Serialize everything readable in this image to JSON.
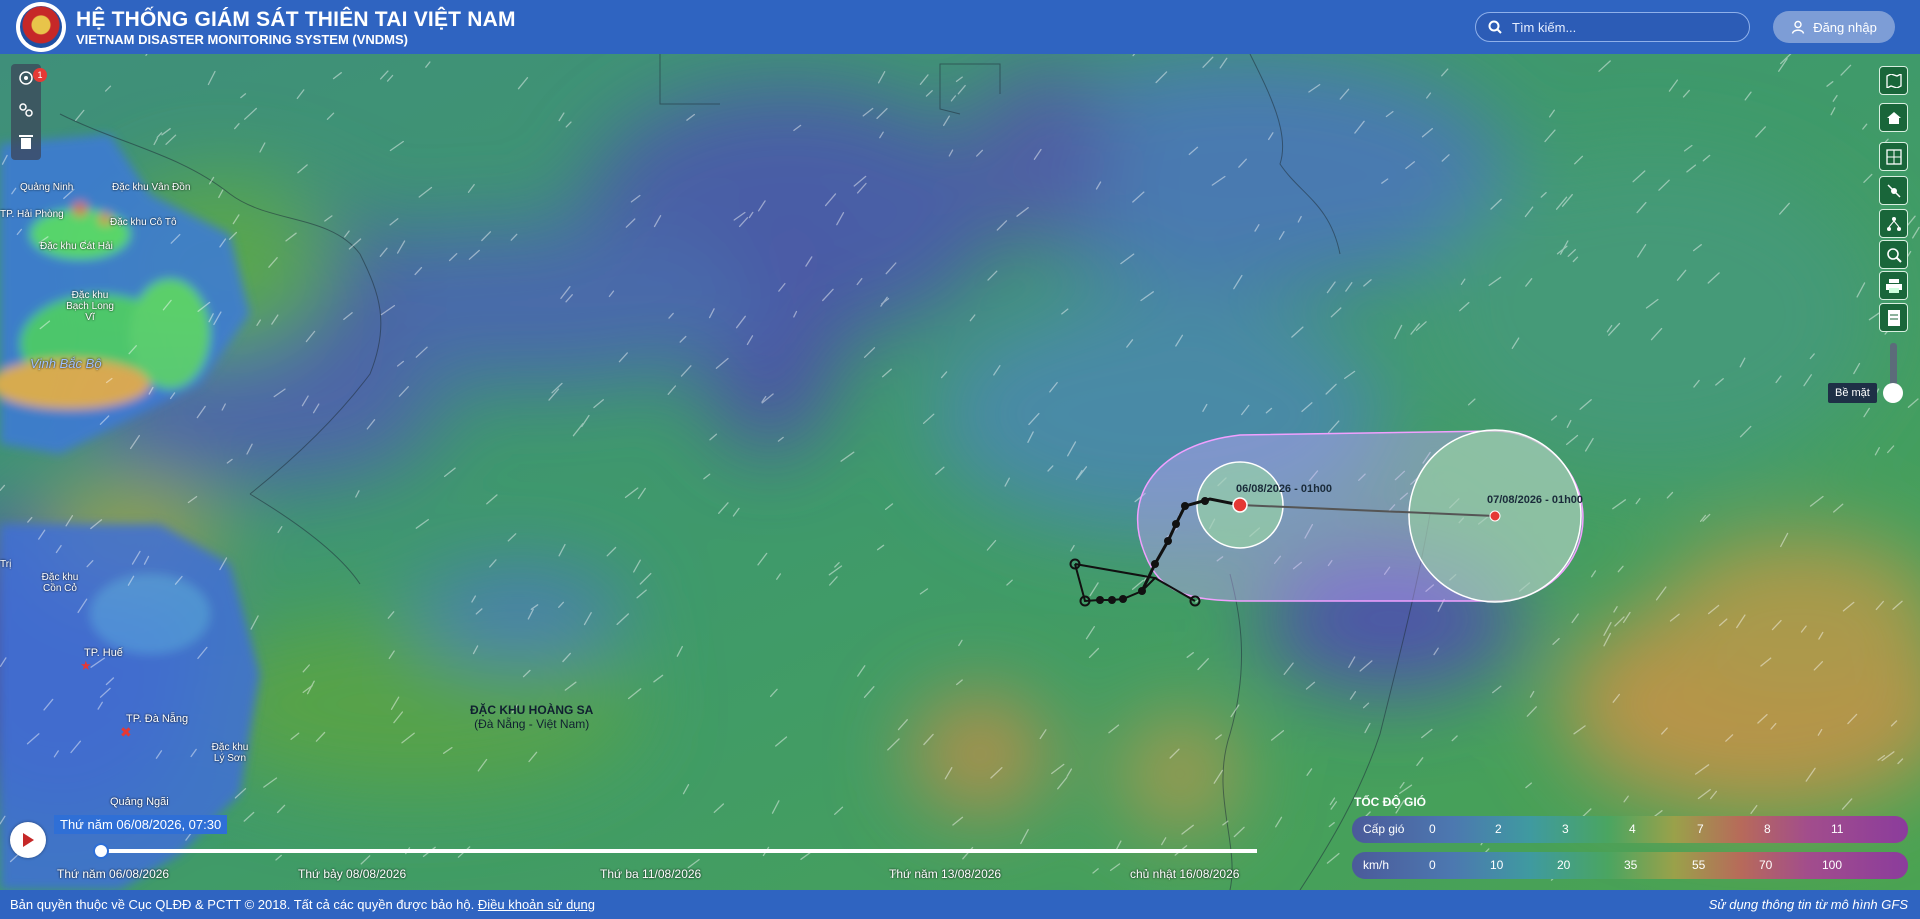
{
  "header": {
    "title": "HỆ THỐNG GIÁM SÁT THIÊN TAI VIỆT NAM",
    "subtitle": "VIETNAM DISASTER MONITORING SYSTEM (VNDMS)",
    "search_placeholder": "Tìm kiếm...",
    "login_label": "Đăng nhập"
  },
  "left_tools": {
    "badge_count": "1"
  },
  "right_tools": {
    "surface_label": "Bề mặt"
  },
  "map_labels": [
    "Quảng Ninh",
    "Đặc khu Vân Đồn",
    "TP. Hải Phòng",
    "Đặc khu Cô Tô",
    "Đặc khu Cát Hải",
    "Đặc khu Bạch Long Vĩ",
    "Vịnh Bắc Bộ",
    "Trị",
    "Đặc khu Cồn Cỏ",
    "TP. Huế",
    "TP. Đà Nẵng",
    "Đặc khu Lý Sơn",
    "Quảng Ngãi"
  ],
  "archipelago": {
    "line1": "ĐẶC KHU HOÀNG SA",
    "line2": "(Đà Nẵng - Việt Nam)"
  },
  "storm": {
    "points": [
      {
        "label": "06/08/2026 - 01h00"
      },
      {
        "label": "07/08/2026 - 01h00"
      }
    ]
  },
  "timeline": {
    "current": "Thứ năm 06/08/2026, 07:30",
    "ticks": [
      "Thứ năm 06/08/2026",
      "Thứ bảy 08/08/2026",
      "Thứ ba 11/08/2026",
      "Thứ năm 13/08/2026",
      "chủ nhật 16/08/2026"
    ]
  },
  "legend": {
    "title": "TỐC ĐỘ GIÓ",
    "row1_label": "Cấp gió",
    "row1_values": [
      "0",
      "2",
      "3",
      "4",
      "7",
      "8",
      "11"
    ],
    "row2_label": "km/h",
    "row2_values": [
      "0",
      "10",
      "20",
      "35",
      "55",
      "70",
      "100"
    ]
  },
  "footer": {
    "copyright": "Bản quyền thuộc về Cục QLĐĐ & PCTT © 2018. Tất cả các quyền được bảo hộ.",
    "terms_link": "Điều khoản sử dụng",
    "source": "Sử dụng thông tin từ mô hình GFS"
  },
  "colors": {
    "header": "#2f64c1",
    "toolbar": "#19663a",
    "storm_center": "#e53935"
  }
}
